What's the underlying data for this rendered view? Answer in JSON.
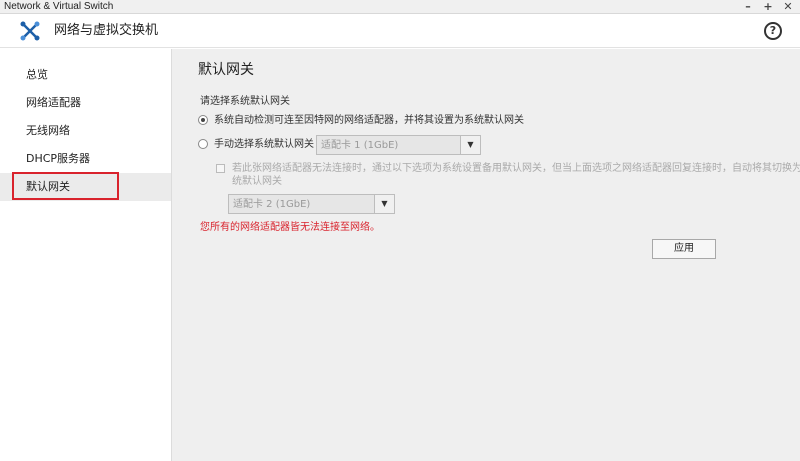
{
  "window": {
    "title": "Network & Virtual Switch"
  },
  "header": {
    "title": "网络与虚拟交换机",
    "help_label": "?"
  },
  "sidebar": {
    "items": [
      {
        "label": "总览"
      },
      {
        "label": "网络适配器"
      },
      {
        "label": "无线网络"
      },
      {
        "label": "DHCP服务器"
      },
      {
        "label": "默认网关"
      }
    ]
  },
  "main": {
    "title": "默认网关",
    "prompt": "请选择系统默认网关",
    "option_auto": "系统自动检测可连至因特网的网络适配器，并将其设置为系统默认网关",
    "option_manual": "手动选择系统默认网关",
    "manual_select": "适配卡 1 (1GbE)",
    "fallback_line1": "若此张网络适配器无法连接时，通过以下选项为系统设置备用默认网关，但当上面选项之网络适配器回复连接时，自动将其切换为系",
    "fallback_line2": "统默认网关",
    "fallback_select": "适配卡 2 (1GbE)",
    "error": "您所有的网络适配器皆无法连接至网络。",
    "apply_label": "应用"
  }
}
